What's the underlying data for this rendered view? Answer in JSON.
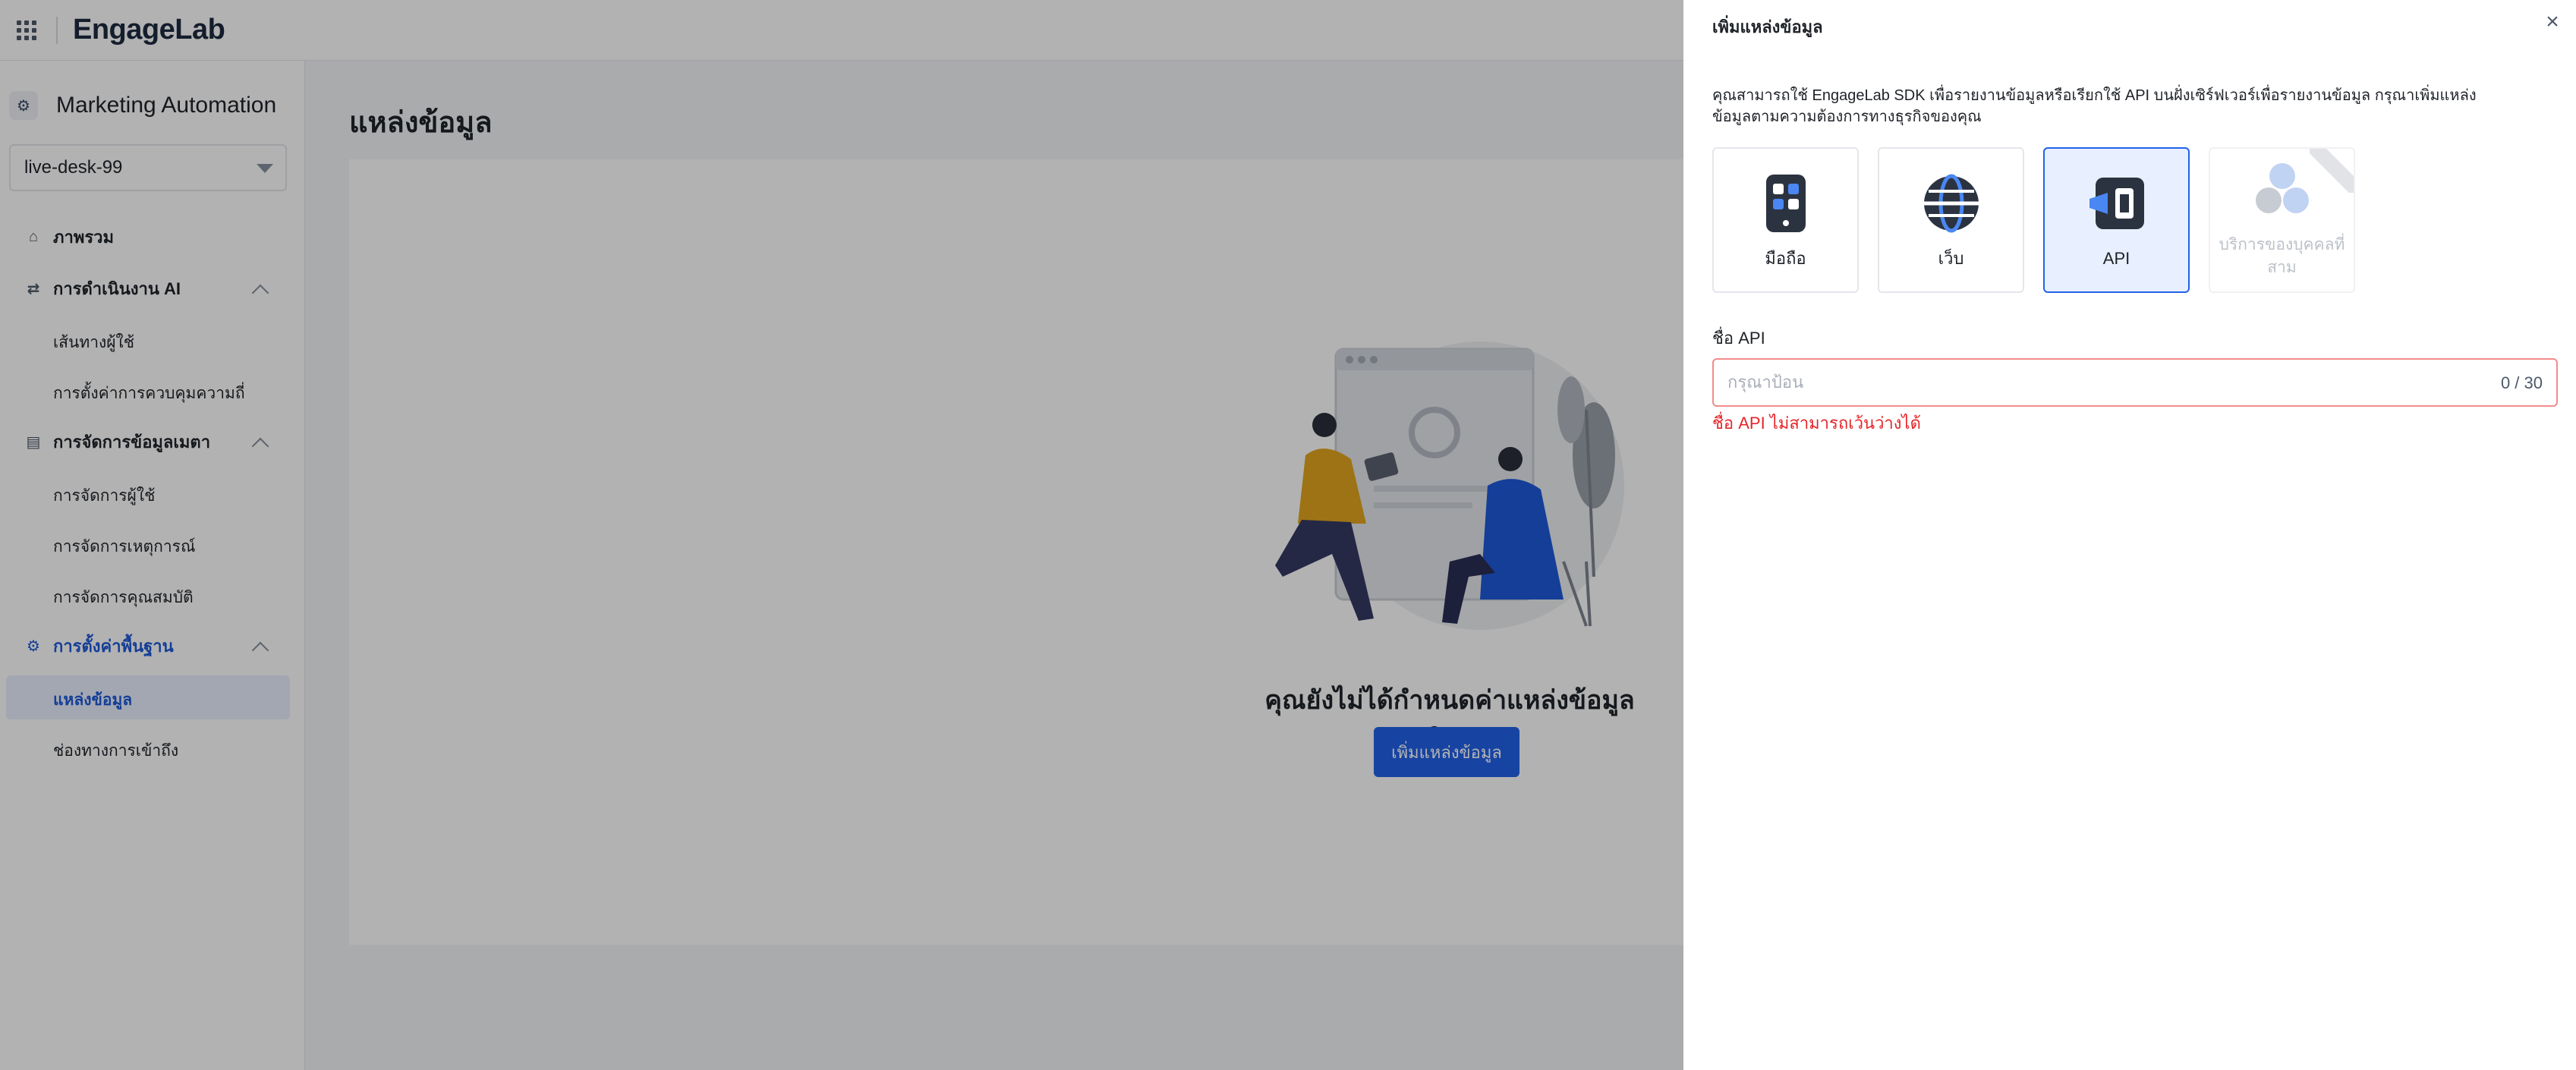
{
  "topbar": {
    "logo": "EngageLab",
    "apps_icon": "apps-grid-icon"
  },
  "sidebar": {
    "product_name": "Marketing Automation",
    "project_select": "live-desk-99",
    "nav": {
      "overview": "ภาพรวม",
      "ai_ops": "การดำเนินงาน AI",
      "ai_ops_children": [
        "เส้นทางผู้ใช้",
        "การตั้งค่าการควบคุมความถี่"
      ],
      "metadata": "การจัดการข้อมูลเมตา",
      "metadata_children": [
        "การจัดการผู้ใช้",
        "การจัดการเหตุการณ์",
        "การจัดการคุณสมบัติ"
      ],
      "basic_settings": "การตั้งค่าพื้นฐาน",
      "basic_settings_children": [
        "แหล่งข้อมูล",
        "ช่องทางการเข้าถึง"
      ]
    }
  },
  "main": {
    "page_title": "แหล่งข้อมูล",
    "empty_text": "คุณยังไม่ได้กำหนดค่าแหล่งข้อมูลใดๆ",
    "add_button": "เพิ่มแหล่งข้อมูล"
  },
  "drawer": {
    "title": "เพิ่มแหล่งข้อมูล",
    "description": "คุณสามารถใช้ EngageLab SDK เพื่อรายงานข้อมูลหรือเรียกใช้ API บนฝั่งเซิร์ฟเวอร์เพื่อรายงานข้อมูล กรุณาเพิ่มแหล่งข้อมูลตามความต้องการทางธุรกิจของคุณ",
    "source_cards": [
      {
        "label": "มือถือ",
        "icon": "mobile-icon"
      },
      {
        "label": "เว็บ",
        "icon": "web-globe-icon"
      },
      {
        "label": "API",
        "icon": "api-plug-icon",
        "selected": true
      },
      {
        "label": "บริการของบุคคลที่สาม",
        "icon": "third-party-icon",
        "disabled": true
      }
    ],
    "field": {
      "label": "ชื่อ API",
      "placeholder": "กรุณาป้อน",
      "value": "",
      "counter": "0 / 30",
      "error": "ชื่อ API ไม่สามารถเว้นว่างได้"
    }
  },
  "colors": {
    "primary": "#2162e8",
    "active_bg": "#e8f0ff",
    "error": "#e5252a",
    "mask": "rgba(0,0,0,0.30)"
  }
}
